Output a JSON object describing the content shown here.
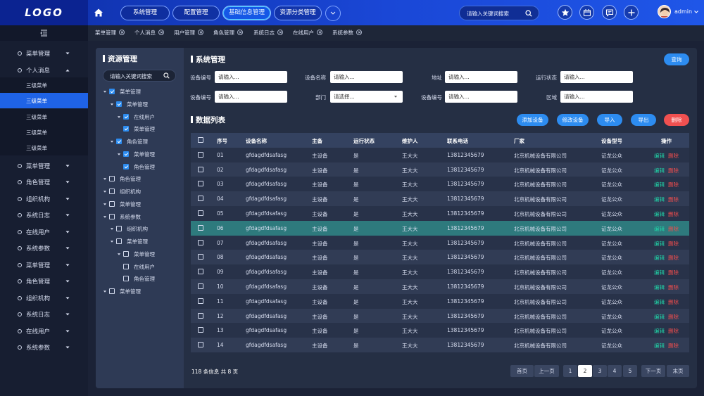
{
  "header": {
    "logo": "LOGO",
    "nav_tabs": [
      "系统管理",
      "配置管理",
      "基础信息管理",
      "资源分类管理"
    ],
    "active_nav_index": 2,
    "search_placeholder": "请输入关键词搜索",
    "username": "admin"
  },
  "sidebar": {
    "items": [
      {
        "label": "菜单管理",
        "expanded": false
      },
      {
        "label": "个人消息",
        "expanded": true
      },
      {
        "label": "菜单管理",
        "expanded": false
      },
      {
        "label": "角色管理",
        "expanded": false
      },
      {
        "label": "组织机构",
        "expanded": false
      },
      {
        "label": "系统日志",
        "expanded": false
      },
      {
        "label": "在线用户",
        "expanded": false
      },
      {
        "label": "系统参数",
        "expanded": false
      },
      {
        "label": "菜单管理",
        "expanded": false
      },
      {
        "label": "角色管理",
        "expanded": false
      },
      {
        "label": "组织机构",
        "expanded": false
      },
      {
        "label": "系统日志",
        "expanded": false
      },
      {
        "label": "在线用户",
        "expanded": false
      },
      {
        "label": "系统参数",
        "expanded": false
      }
    ],
    "sub_items": [
      {
        "label": "三级菜单",
        "active": false
      },
      {
        "label": "三级菜单",
        "active": true
      },
      {
        "label": "三级菜单",
        "active": false
      },
      {
        "label": "三级菜单",
        "active": false
      },
      {
        "label": "三级菜单",
        "active": false
      }
    ]
  },
  "open_tabs": [
    "菜单管理",
    "个人消息",
    "用户管理",
    "角色管理",
    "系统日志",
    "在线用户",
    "系统参数"
  ],
  "tree": {
    "title": "资源管理",
    "search_placeholder": "请输入关键词搜索",
    "nodes": [
      {
        "label": "菜单管理",
        "checked": true,
        "has_caret": true
      },
      {
        "label": "菜单管理",
        "checked": true,
        "has_caret": true
      },
      {
        "label": "在线用户",
        "checked": true,
        "has_caret": true
      },
      {
        "label": "菜单管理",
        "checked": true,
        "has_caret": false
      },
      {
        "label": "角色管理",
        "checked": true,
        "has_caret": true
      },
      {
        "label": "菜单管理",
        "checked": true,
        "has_caret": true
      },
      {
        "label": "角色管理",
        "checked": true,
        "has_caret": false
      },
      {
        "label": "角色管理",
        "checked": false,
        "has_caret": true
      },
      {
        "label": "组织机构",
        "checked": false,
        "has_caret": true
      },
      {
        "label": "菜单管理",
        "checked": false,
        "has_caret": true
      },
      {
        "label": "系统参数",
        "checked": false,
        "has_caret": true
      },
      {
        "label": "组织机构",
        "checked": false,
        "has_caret": true
      },
      {
        "label": "菜单管理",
        "checked": false,
        "has_caret": true
      },
      {
        "label": "菜单管理",
        "checked": false,
        "has_caret": true
      },
      {
        "label": "在线用户",
        "checked": false,
        "has_caret": false
      },
      {
        "label": "角色管理",
        "checked": false,
        "has_caret": false
      },
      {
        "label": "菜单管理",
        "checked": false,
        "has_caret": true
      }
    ]
  },
  "system": {
    "title": "系统管理",
    "query_label": "查询",
    "form_row1": [
      {
        "label": "设备编号",
        "placeholder": "请输入..."
      },
      {
        "label": "设备名称",
        "placeholder": "请输入..."
      },
      {
        "label": "地址",
        "placeholder": "请输入..."
      },
      {
        "label": "运行状态",
        "placeholder": "请输入..."
      }
    ],
    "form_row2": [
      {
        "label": "设备编号",
        "placeholder": "请输入..."
      },
      {
        "label": "部门",
        "placeholder": "请选择..."
      },
      {
        "label": "设备编号",
        "placeholder": "请输入..."
      },
      {
        "label": "区域",
        "placeholder": "请输入..."
      }
    ]
  },
  "list": {
    "title": "数据列表",
    "buttons": [
      {
        "label": "添加设备",
        "color": "#2d8cf0"
      },
      {
        "label": "修改设备",
        "color": "#2d8cf0"
      },
      {
        "label": "导入",
        "color": "#2d8cf0"
      },
      {
        "label": "导出",
        "color": "#2d8cf0"
      },
      {
        "label": "删除",
        "color": "#f05050"
      }
    ],
    "headers": [
      "序号",
      "设备名称",
      "主备",
      "运行状态",
      "维护人",
      "联系电话",
      "厂家",
      "设备型号",
      "操作"
    ],
    "edit_label": "编辑",
    "delete_label": "删除",
    "selected_row": 5,
    "rows": [
      [
        "01",
        "gfdagdfdsafasg",
        "主设备",
        "是",
        "王大大",
        "13812345679",
        "北京机械设备有限公司",
        "证龙公众"
      ],
      [
        "02",
        "gfdagdfdsafasg",
        "主设备",
        "是",
        "王大大",
        "13812345679",
        "北京机械设备有限公司",
        "证龙公众"
      ],
      [
        "03",
        "gfdagdfdsafasg",
        "主设备",
        "是",
        "王大大",
        "13812345679",
        "北京机械设备有限公司",
        "证龙公众"
      ],
      [
        "04",
        "gfdagdfdsafasg",
        "主设备",
        "是",
        "王大大",
        "13812345679",
        "北京机械设备有限公司",
        "证龙公众"
      ],
      [
        "05",
        "gfdagdfdsafasg",
        "主设备",
        "是",
        "王大大",
        "13812345679",
        "北京机械设备有限公司",
        "证龙公众"
      ],
      [
        "06",
        "gfdagdfdsafasg",
        "主设备",
        "是",
        "王大大",
        "13812345679",
        "北京机械设备有限公司",
        "证龙公众"
      ],
      [
        "07",
        "gfdagdfdsafasg",
        "主设备",
        "是",
        "王大大",
        "13812345679",
        "北京机械设备有限公司",
        "证龙公众"
      ],
      [
        "08",
        "gfdagdfdsafasg",
        "主设备",
        "是",
        "王大大",
        "13812345679",
        "北京机械设备有限公司",
        "证龙公众"
      ],
      [
        "09",
        "gfdagdfdsafasg",
        "主设备",
        "是",
        "王大大",
        "13812345679",
        "北京机械设备有限公司",
        "证龙公众"
      ],
      [
        "10",
        "gfdagdfdsafasg",
        "主设备",
        "是",
        "王大大",
        "13812345679",
        "北京机械设备有限公司",
        "证龙公众"
      ],
      [
        "11",
        "gfdagdfdsafasg",
        "主设备",
        "是",
        "王大大",
        "13812345679",
        "北京机械设备有限公司",
        "证龙公众"
      ],
      [
        "12",
        "gfdagdfdsafasg",
        "主设备",
        "是",
        "王大大",
        "13812345679",
        "北京机械设备有限公司",
        "证龙公众"
      ],
      [
        "13",
        "gfdagdfdsafasg",
        "主设备",
        "是",
        "王大大",
        "13812345679",
        "北京机械设备有限公司",
        "证龙公众"
      ],
      [
        "14",
        "gfdagdfdsafasg",
        "主设备",
        "是",
        "王大大",
        "13812345679",
        "北京机械设备有限公司",
        "证龙公众"
      ]
    ]
  },
  "pagination": {
    "info": "118 条信息 共 8 页",
    "first": "首页",
    "prev": "上一页",
    "pages": [
      "1",
      "2",
      "3",
      "4",
      "5"
    ],
    "current_page_index": 1,
    "next": "下一页",
    "last": "末页"
  }
}
